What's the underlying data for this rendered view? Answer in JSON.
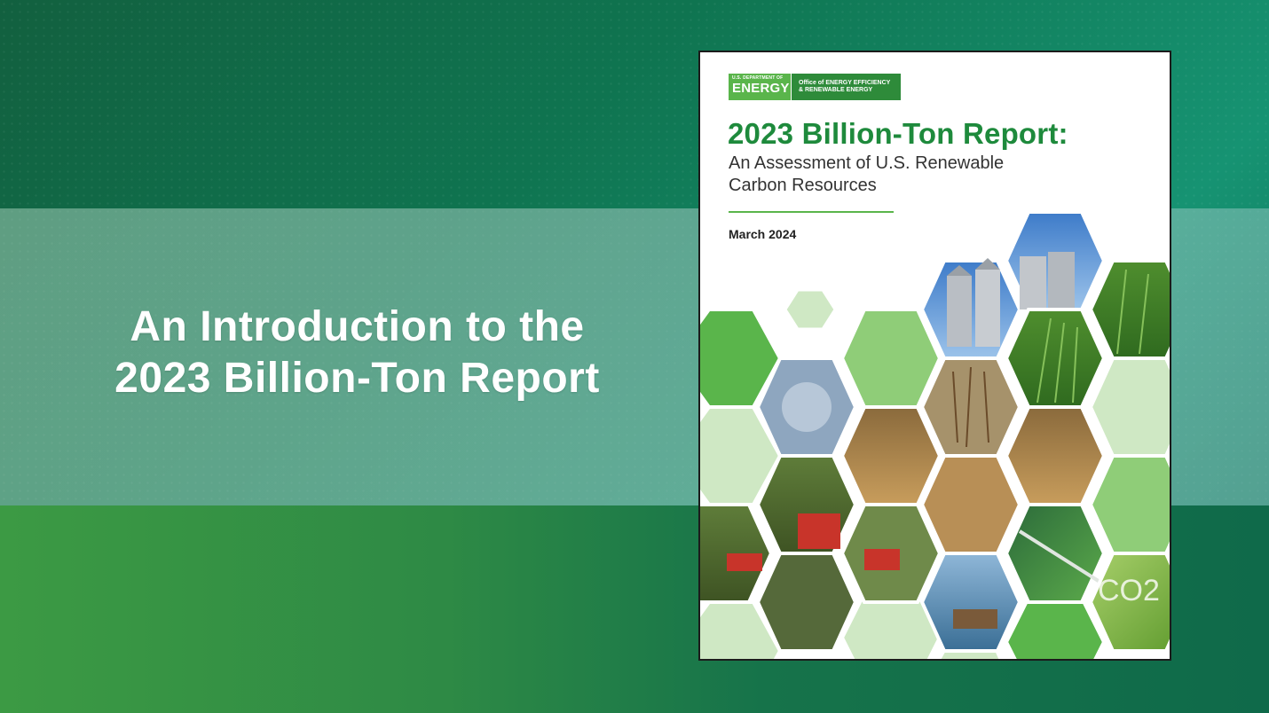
{
  "headline": {
    "line1": "An Introduction to the",
    "line2": "2023 Billion-Ton Report"
  },
  "cover": {
    "logo": {
      "dept_small": "U.S. DEPARTMENT OF",
      "dept_big": "ENERGY",
      "office_line1": "Office of ENERGY EFFICIENCY",
      "office_line2": "& RENEWABLE ENERGY"
    },
    "title": "2023 Billion-Ton Report:",
    "subtitle": "An Assessment of U.S. Renewable Carbon Resources",
    "date": "March 2024",
    "co2_label": "CO2"
  },
  "colors": {
    "brand_green": "#1e8a3c",
    "light_green": "#5ab54b",
    "pale_green": "#cfe8c4"
  },
  "icons": [
    "grain-silos-photo",
    "corn-field-photo",
    "forest-harvester-photo",
    "algae-photo",
    "co2-leaf-photo"
  ]
}
